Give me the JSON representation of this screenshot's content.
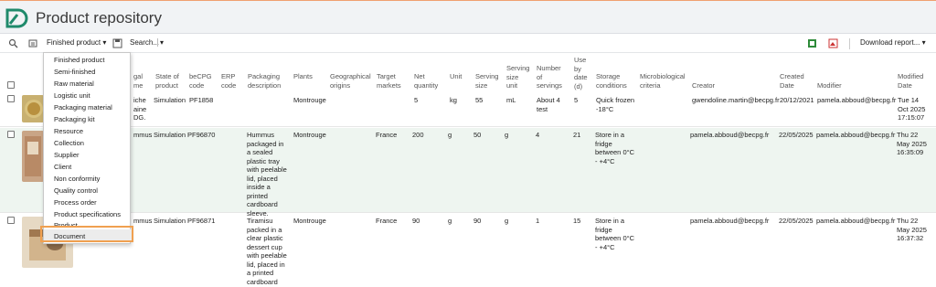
{
  "app": {
    "title": "Product repository"
  },
  "toolbar": {
    "filter_label": "Finished product ▾",
    "search_label": "Search...",
    "download_label": "Download report... ▾"
  },
  "menu": {
    "items": [
      "Finished product",
      "Semi-finished",
      "Raw material",
      "Logistic unit",
      "Packaging material",
      "Packaging kit",
      "Resource",
      "Collection",
      "Supplier",
      "Client",
      "Non conformity",
      "Quality control",
      "Process order",
      "Product specifications",
      "Product",
      "Document"
    ],
    "highlighted": "Document"
  },
  "columns": {
    "legal_name": [
      "gal",
      "me"
    ],
    "state": [
      "State of",
      "product"
    ],
    "becpg_code": [
      "beCPG",
      "code"
    ],
    "erp_code": [
      "ERP",
      "code"
    ],
    "packaging": [
      "Packaging",
      "description"
    ],
    "plants": [
      "Plants"
    ],
    "geo": [
      "Geographical",
      "origins"
    ],
    "target": [
      "Target",
      "markets"
    ],
    "net_qty": [
      "Net",
      "quantity"
    ],
    "unit": [
      "Unit"
    ],
    "serving_size": [
      "Serving",
      "size"
    ],
    "serving_unit": [
      "Serving",
      "size",
      "unit"
    ],
    "servings": [
      "Number",
      "of",
      "servings"
    ],
    "use_by": [
      "Use",
      "by",
      "date",
      "(d)"
    ],
    "storage": [
      "Storage",
      "conditions"
    ],
    "micro": [
      "Microbiological",
      "criteria"
    ],
    "creator": [
      "Creator"
    ],
    "created": [
      "Created",
      "Date"
    ],
    "modifier": [
      "Modifier"
    ],
    "modified": [
      "Modified",
      "Date"
    ]
  },
  "rows": [
    {
      "legal_name": [
        "iche",
        "aine",
        "DG."
      ],
      "state": "Simulation",
      "becpg_code": "PF1858",
      "erp_code": "",
      "packaging": [],
      "plants": "Montrouge",
      "geo": "",
      "target": "",
      "net_qty": "5",
      "unit": "kg",
      "serving_size": "55",
      "serving_unit": "mL",
      "servings": [
        "About 4",
        "test"
      ],
      "use_by": "5",
      "storage": [
        "Quick frozen",
        "-18°C"
      ],
      "creator": "gwendoline.martin@becpg.fr",
      "created": "20/12/2021",
      "modifier": "pamela.abboud@becpg.fr",
      "modified": [
        "Tue 14",
        "Oct 2025",
        "17:15:07"
      ]
    },
    {
      "legal_name": [
        "mmus"
      ],
      "state": "Simulation",
      "becpg_code": "PF96870",
      "erp_code": "",
      "packaging": [
        "Hummus",
        "packaged in",
        "a sealed",
        "plastic tray",
        "with peelable",
        "lid, placed",
        "inside a",
        "printed",
        "cardboard",
        "sleeve."
      ],
      "plants": "Montrouge",
      "geo": "",
      "target": "France",
      "net_qty": "200",
      "unit": "g",
      "serving_size": "50",
      "serving_unit": "g",
      "servings": [
        "4"
      ],
      "use_by": "21",
      "storage": [
        "Store in a",
        "fridge",
        "between 0°C",
        "- +4°C"
      ],
      "creator": "pamela.abboud@becpg.fr",
      "created": "22/05/2025",
      "modifier": "pamela.abboud@becpg.fr",
      "modified": [
        "Thu 22",
        "May 2025",
        "16:35:09"
      ]
    },
    {
      "legal_name": [
        "mmus"
      ],
      "state": "Simulation",
      "becpg_code": "PF96871",
      "erp_code": "",
      "packaging": [
        "Tiramisu",
        "packed in a",
        "clear plastic",
        "dessert cup",
        "with peelable",
        "lid, placed in",
        "a printed",
        "cardboard"
      ],
      "plants": "Montrouge",
      "geo": "",
      "target": "France",
      "net_qty": "90",
      "unit": "g",
      "serving_size": "90",
      "serving_unit": "g",
      "servings": [
        "1"
      ],
      "use_by": "15",
      "storage": [
        "Store in a",
        "fridge",
        "between 0°C",
        "- +4°C"
      ],
      "creator": "pamela.abboud@becpg.fr",
      "created": "22/05/2025",
      "modifier": "pamela.abboud@becpg.fr",
      "modified": [
        "Thu 22",
        "May 2025",
        "16:37:32"
      ]
    }
  ],
  "colors": {
    "accent": "#1f8a6b",
    "highlight_border": "#f0a050",
    "header_bg": "#f1f3f5",
    "row_alt": "#eef5f0"
  }
}
